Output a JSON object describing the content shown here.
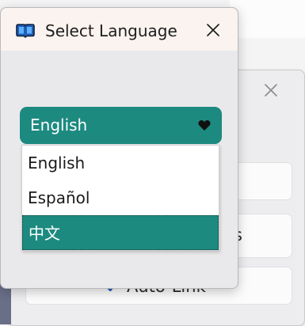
{
  "dialog": {
    "title": "Select Language",
    "icon": "book-icon",
    "close_icon": "close-icon"
  },
  "language_select": {
    "selected": "English",
    "icon": "heart-icon"
  },
  "language_options": [
    {
      "label": "English",
      "highlighted": false
    },
    {
      "label": "Español",
      "highlighted": false
    },
    {
      "label": "中文",
      "highlighted": true
    }
  ],
  "background_window": {
    "close_icon": "close-icon",
    "partial_text": "s",
    "auto_link_label": "Auto-Link",
    "auto_link_checked": true
  },
  "colors": {
    "accent_teal": "#1d8a80",
    "titlebar_bg": "#faf3ef",
    "dialog_bg": "#e9e9eb",
    "icon_blue": "#1f5fb8"
  }
}
